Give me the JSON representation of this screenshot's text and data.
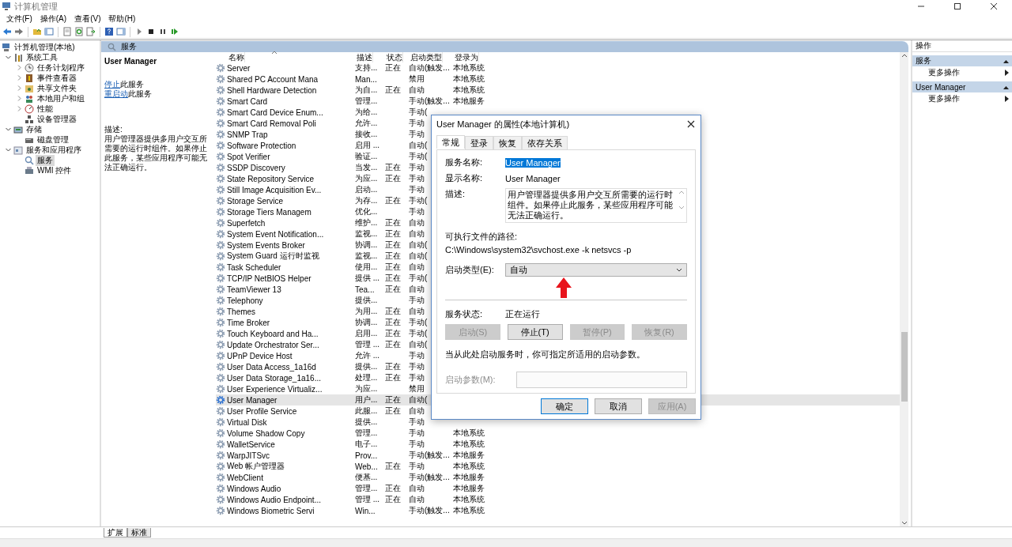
{
  "window": {
    "title": "计算机管理"
  },
  "menu": [
    "文件(F)",
    "操作(A)",
    "查看(V)",
    "帮助(H)"
  ],
  "tree": [
    {
      "label": "计算机管理(本地)",
      "kind": "root",
      "selected": false,
      "children": [
        {
          "label": "系统工具",
          "kind": "folder",
          "expanded": true,
          "selected": false,
          "children": [
            {
              "label": "任务计划程序",
              "kind": "folder",
              "expanded": false,
              "selected": false
            },
            {
              "label": "事件查看器",
              "kind": "folder",
              "expanded": false,
              "selected": false
            },
            {
              "label": "共享文件夹",
              "kind": "folder",
              "expanded": false,
              "selected": false
            },
            {
              "label": "本地用户和组",
              "kind": "folder",
              "expanded": false,
              "selected": false
            },
            {
              "label": "性能",
              "kind": "folder",
              "expanded": false,
              "selected": false
            },
            {
              "label": "设备管理器",
              "kind": "leaf",
              "selected": false
            }
          ]
        },
        {
          "label": "存储",
          "kind": "folder",
          "expanded": true,
          "selected": false,
          "children": [
            {
              "label": "磁盘管理",
              "kind": "leaf",
              "selected": false
            }
          ]
        },
        {
          "label": "服务和应用程序",
          "kind": "folder",
          "expanded": true,
          "selected": false,
          "children": [
            {
              "label": "服务",
              "kind": "leaf",
              "selected": true
            },
            {
              "label": "WMI 控件",
              "kind": "leaf",
              "selected": false
            }
          ]
        }
      ]
    }
  ],
  "pane_header": {
    "title": "服务"
  },
  "details": {
    "title": "User Manager",
    "actions": [
      {
        "link": "停止",
        "text": "此服务"
      },
      {
        "link": "重启动",
        "text": "此服务"
      }
    ],
    "description_label": "描述:",
    "description": "用户管理器提供多用户交互所需要的运行时组件。如果停止此服务，某些应用程序可能无法正确运行。"
  },
  "table": {
    "columns": [
      {
        "label": "名称",
        "sorted": true
      },
      {
        "label": "描述",
        "sorted": false
      },
      {
        "label": "状态",
        "sorted": false
      },
      {
        "label": "启动类型",
        "sorted": false
      },
      {
        "label": "登录为",
        "sorted": false
      }
    ],
    "rows": [
      {
        "name": "Server",
        "description": "支持...",
        "status": "正在",
        "startup": "自动(触发...",
        "logon": "本地系统",
        "selected": false
      },
      {
        "name": "Shared PC Account Mana",
        "description": "Man...",
        "startup": "禁用",
        "logon": "本地系统",
        "selected": false
      },
      {
        "name": "Shell Hardware Detection",
        "description": "为自...",
        "status": "正在",
        "startup": "自动",
        "logon": "本地系统",
        "selected": false
      },
      {
        "name": "Smart Card",
        "description": "管理...",
        "startup": "手动(触发...",
        "logon": "本地服务",
        "selected": false
      },
      {
        "name": "Smart Card Device Enum...",
        "description": "为给...",
        "startup": "手动(",
        "selected": false
      },
      {
        "name": "Smart Card Removal Poli",
        "description": "允许...",
        "startup": "手动",
        "selected": false
      },
      {
        "name": "SNMP Trap",
        "description": "接收...",
        "startup": "手动",
        "selected": false
      },
      {
        "name": "Software Protection",
        "description": "启用 ...",
        "startup": "自动(",
        "selected": false
      },
      {
        "name": "Spot Verifier",
        "description": "验证...",
        "startup": "手动(",
        "selected": false
      },
      {
        "name": "SSDP Discovery",
        "description": "当发...",
        "status": "正在",
        "startup": "手动",
        "selected": false
      },
      {
        "name": "State Repository Service",
        "description": "为应...",
        "status": "正在",
        "startup": "手动",
        "selected": false
      },
      {
        "name": "Still Image Acquisition Ev...",
        "description": "启动...",
        "startup": "手动",
        "selected": false
      },
      {
        "name": "Storage Service",
        "description": "为存...",
        "status": "正在",
        "startup": "手动(",
        "selected": false
      },
      {
        "name": "Storage Tiers Managem",
        "description": "优化...",
        "startup": "手动",
        "selected": false
      },
      {
        "name": "Superfetch",
        "description": "维护...",
        "status": "正在",
        "startup": "自动",
        "selected": false
      },
      {
        "name": "System Event Notification...",
        "description": "监视...",
        "status": "正在",
        "startup": "自动",
        "selected": false
      },
      {
        "name": "System Events Broker",
        "description": "协调...",
        "status": "正在",
        "startup": "自动(",
        "selected": false
      },
      {
        "name": "System Guard 运行时监视",
        "description": "监视...",
        "status": "正在",
        "startup": "自动(",
        "selected": false
      },
      {
        "name": "Task Scheduler",
        "description": "使用...",
        "status": "正在",
        "startup": "自动",
        "selected": false
      },
      {
        "name": "TCP/IP NetBIOS Helper",
        "description": "提供 ...",
        "status": "正在",
        "startup": "手动(",
        "selected": false
      },
      {
        "name": "TeamViewer 13",
        "description": "Tea...",
        "status": "正在",
        "startup": "自动",
        "selected": false
      },
      {
        "name": "Telephony",
        "description": "提供...",
        "startup": "手动",
        "selected": false
      },
      {
        "name": "Themes",
        "description": "为用...",
        "status": "正在",
        "startup": "自动",
        "selected": false
      },
      {
        "name": "Time Broker",
        "description": "协调...",
        "status": "正在",
        "startup": "手动(",
        "selected": false
      },
      {
        "name": "Touch Keyboard and Ha...",
        "description": "启用...",
        "status": "正在",
        "startup": "手动(",
        "selected": false
      },
      {
        "name": "Update Orchestrator Ser...",
        "description": "管理 ...",
        "status": "正在",
        "startup": "自动(",
        "selected": false
      },
      {
        "name": "UPnP Device Host",
        "description": "允许 ...",
        "startup": "手动",
        "selected": false
      },
      {
        "name": "User Data Access_1a16d",
        "description": "提供...",
        "status": "正在",
        "startup": "手动",
        "selected": false
      },
      {
        "name": "User Data Storage_1a16...",
        "description": "处理...",
        "status": "正在",
        "startup": "手动",
        "selected": false
      },
      {
        "name": "User Experience Virtualiz...",
        "description": "为应...",
        "startup": "禁用",
        "selected": false
      },
      {
        "name": "User Manager",
        "description": "用户...",
        "status": "正在",
        "startup": "自动(",
        "selected": true
      },
      {
        "name": "User Profile Service",
        "description": "此服...",
        "status": "正在",
        "startup": "自动",
        "selected": false
      },
      {
        "name": "Virtual Disk",
        "description": "提供...",
        "startup": "手动",
        "selected": false
      },
      {
        "name": "Volume Shadow Copy",
        "description": "管理...",
        "startup": "手动",
        "logon": "本地系统",
        "selected": false
      },
      {
        "name": "WalletService",
        "description": "电子...",
        "startup": "手动",
        "logon": "本地系统",
        "selected": false
      },
      {
        "name": "WarpJITSvc",
        "description": "Prov...",
        "startup": "手动(触发...",
        "logon": "本地服务",
        "selected": false
      },
      {
        "name": "Web 帐户管理器",
        "description": "Web...",
        "status": "正在",
        "startup": "手动",
        "logon": "本地系统",
        "selected": false
      },
      {
        "name": "WebClient",
        "description": "便基...",
        "startup": "手动(触发...",
        "logon": "本地服务",
        "selected": false
      },
      {
        "name": "Windows Audio",
        "description": "管理...",
        "status": "正在",
        "startup": "自动",
        "logon": "本地服务",
        "selected": false
      },
      {
        "name": "Windows Audio Endpoint...",
        "description": "管理 ...",
        "status": "正在",
        "startup": "自动",
        "logon": "本地系统",
        "selected": false
      },
      {
        "name": "Windows Biometric Servi",
        "description": "Win...",
        "startup": "手动(触发...",
        "logon": "本地系统",
        "selected": false
      }
    ]
  },
  "dialog": {
    "title": "User Manager 的属性(本地计算机)",
    "tabs": [
      {
        "label": "常规",
        "selected": true
      },
      {
        "label": "登录",
        "selected": false
      },
      {
        "label": "恢复",
        "selected": false
      },
      {
        "label": "依存关系",
        "selected": false
      }
    ],
    "service_name_label": "服务名称:",
    "service_name": "User Manager",
    "display_name_label": "显示名称:",
    "display_name": "User Manager",
    "description_label": "描述:",
    "description": "用户管理器提供多用户交互所需要的运行时组件。如果停止此服务，某些应用程序可能无法正确运行。",
    "path_label": "可执行文件的路径:",
    "path": "C:\\Windows\\system32\\svchost.exe -k netsvcs -p",
    "startup_label": "启动类型(E):",
    "startup": "自动",
    "status_label": "服务状态:",
    "status": "正在运行",
    "service_buttons": [
      {
        "label": "启动(S)",
        "disabled": true
      },
      {
        "label": "停止(T)",
        "disabled": false
      },
      {
        "label": "暂停(P)",
        "disabled": true
      },
      {
        "label": "恢复(R)",
        "disabled": true
      }
    ],
    "note": "当从此处启动服务时，你可指定所适用的启动参数。",
    "params": {
      "label": "启动参数(M):",
      "disabled": true
    },
    "buttons": [
      {
        "label": "确定",
        "disabled": false,
        "default": true
      },
      {
        "label": "取消",
        "disabled": false,
        "default": false
      },
      {
        "label": "应用(A)",
        "disabled": true,
        "default": false
      }
    ]
  },
  "actions_pane": {
    "title": "操作",
    "sections": [
      {
        "title": "服务",
        "expanded": true,
        "items": [
          "更多操作"
        ]
      },
      {
        "title": "User Manager",
        "expanded": true,
        "items": [
          "更多操作"
        ]
      }
    ]
  },
  "bottom_tabs": [
    {
      "label": "扩展",
      "selected": true
    },
    {
      "label": "标准",
      "selected": false
    }
  ]
}
